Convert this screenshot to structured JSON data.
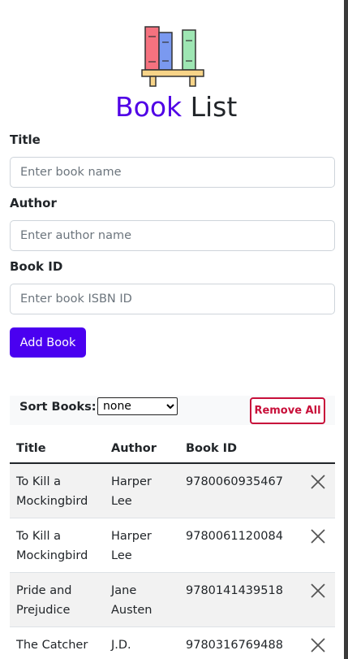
{
  "app": {
    "title_accent": "Book",
    "title_rest": " List"
  },
  "form": {
    "title_label": "Title",
    "title_placeholder": "Enter book name",
    "author_label": "Author",
    "author_placeholder": "Enter author name",
    "id_label": "Book ID",
    "id_placeholder": "Enter book ISBN ID",
    "add_button": "Add Book"
  },
  "sort": {
    "label": "Sort Books:",
    "selected": "none",
    "remove_all": "Remove All"
  },
  "table": {
    "headers": [
      "Title",
      "Author",
      "Book ID"
    ],
    "rows": [
      {
        "title": "To Kill a Mockingbird",
        "author": "Harper Lee",
        "id": "9780060935467"
      },
      {
        "title": "To Kill a Mockingbird",
        "author": "Harper Lee",
        "id": "9780061120084"
      },
      {
        "title": "Pride and Prejudice",
        "author": "Jane Austen",
        "id": "9780141439518"
      },
      {
        "title": "The Catcher in the Rye",
        "author": "J.D. Salinger",
        "id": "9780316769488"
      }
    ]
  },
  "icons": {
    "logo": "bookshelf-icon",
    "delete": "close-icon"
  },
  "colors": {
    "accent": "#5000e6",
    "danger": "#c8103a"
  }
}
